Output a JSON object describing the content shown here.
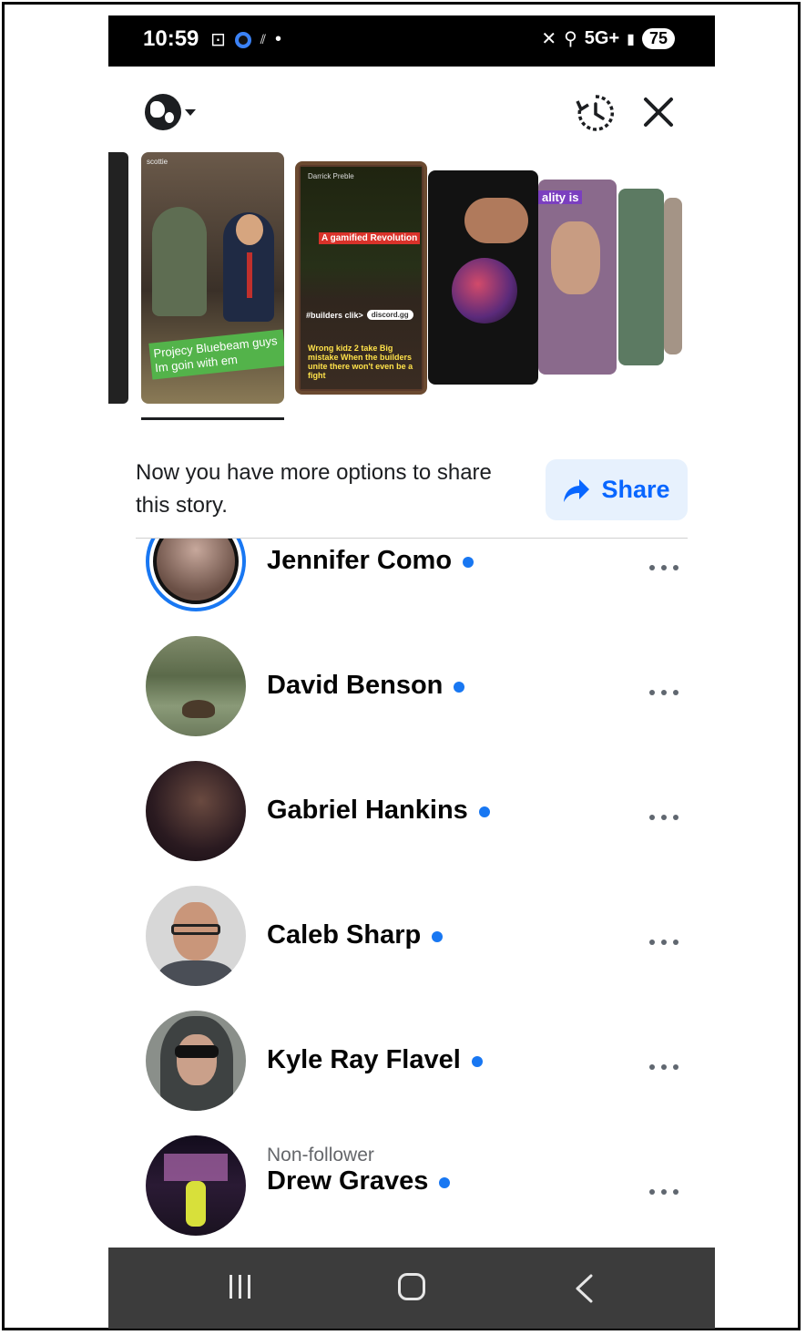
{
  "status_bar": {
    "time": "10:59",
    "network": "5G+",
    "battery": "75"
  },
  "share_prompt": {
    "text": "Now you have more options to share this story.",
    "button_label": "Share"
  },
  "stories": [
    {
      "header": "",
      "caption": ""
    },
    {
      "header": "scottie",
      "caption": "Projecy Bluebeam guys Im goin with em"
    },
    {
      "header": "Darrick Preble",
      "caption": "A gamified Revolution",
      "hashtag": "#builders clik>",
      "link": "discord.gg",
      "bottom": "Wrong kidz 2 take Big mistake When the builders unite there won't even be a fight"
    },
    {
      "header": "",
      "caption": ""
    },
    {
      "header": "",
      "caption": "ality is"
    },
    {
      "header": "",
      "caption": ""
    }
  ],
  "people": [
    {
      "name": "Jennifer Como",
      "subtitle": "",
      "online": true
    },
    {
      "name": "David Benson",
      "subtitle": "",
      "online": true
    },
    {
      "name": "Gabriel Hankins",
      "subtitle": "",
      "online": true
    },
    {
      "name": "Caleb Sharp",
      "subtitle": "",
      "online": true
    },
    {
      "name": "Kyle Ray Flavel",
      "subtitle": "",
      "online": true
    },
    {
      "name": "Drew Graves",
      "subtitle": "Non-follower",
      "online": true
    }
  ],
  "colors": {
    "accent": "#1877f2",
    "share_bg": "#e7f1fd",
    "share_text": "#0866ff",
    "navbar": "#3c3c3c"
  }
}
